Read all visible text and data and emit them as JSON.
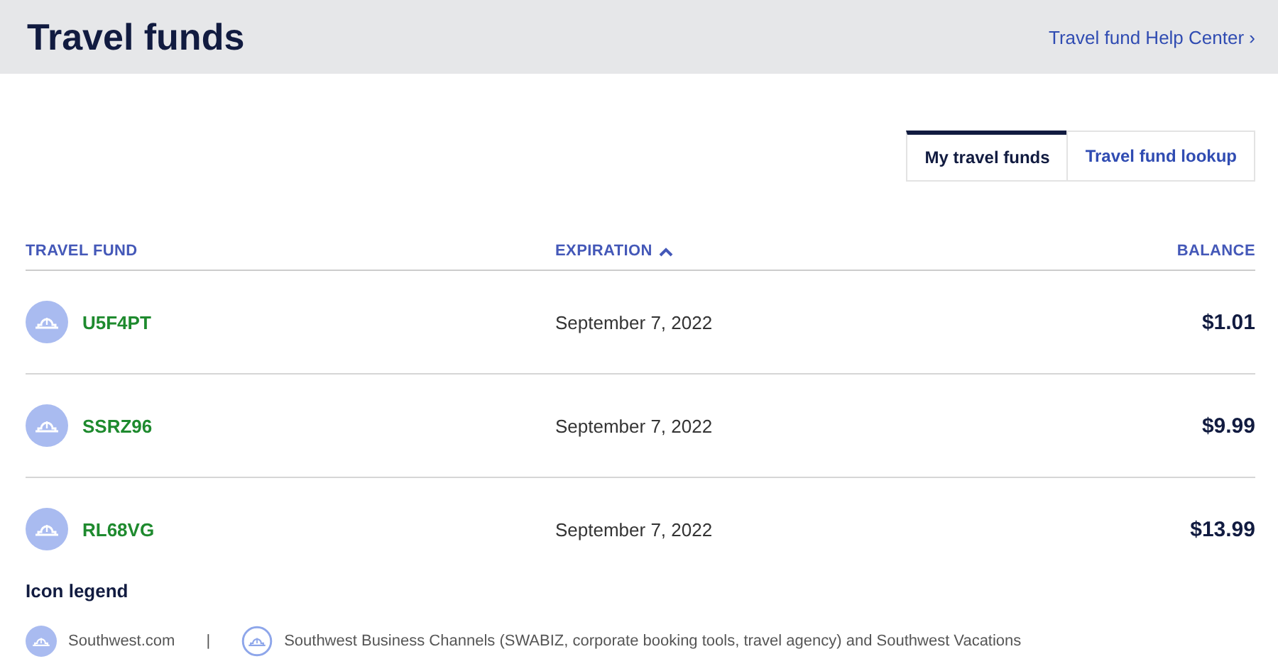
{
  "header": {
    "title": "Travel funds",
    "help_link": "Travel fund Help Center ›"
  },
  "tabs": [
    {
      "label": "My travel funds",
      "selected": true
    },
    {
      "label": "Travel fund lookup",
      "selected": false
    }
  ],
  "table": {
    "columns": [
      {
        "label": "TRAVEL FUND",
        "sorted": false
      },
      {
        "label": "EXPIRATION",
        "sorted": true
      },
      {
        "label": "BALANCE",
        "sorted": false
      }
    ],
    "rows": [
      {
        "kind": "filled",
        "code": "U5F4PT",
        "expiration": "September 7, 2022",
        "balance": "$1.01"
      },
      {
        "kind": "filled",
        "code": "SSRZ96",
        "expiration": "September 7, 2022",
        "balance": "$9.99"
      },
      {
        "kind": "filled",
        "code": "RL68VG",
        "expiration": "September 7, 2022",
        "balance": "$13.99"
      }
    ]
  },
  "legend": {
    "title": "Icon legend",
    "separator": "|",
    "items": [
      {
        "kind": "filled",
        "label": "Southwest.com"
      },
      {
        "kind": "outline",
        "label": "Southwest Business Channels (SWABIZ, corporate booking tools, travel agency) and Southwest Vacations"
      }
    ]
  }
}
